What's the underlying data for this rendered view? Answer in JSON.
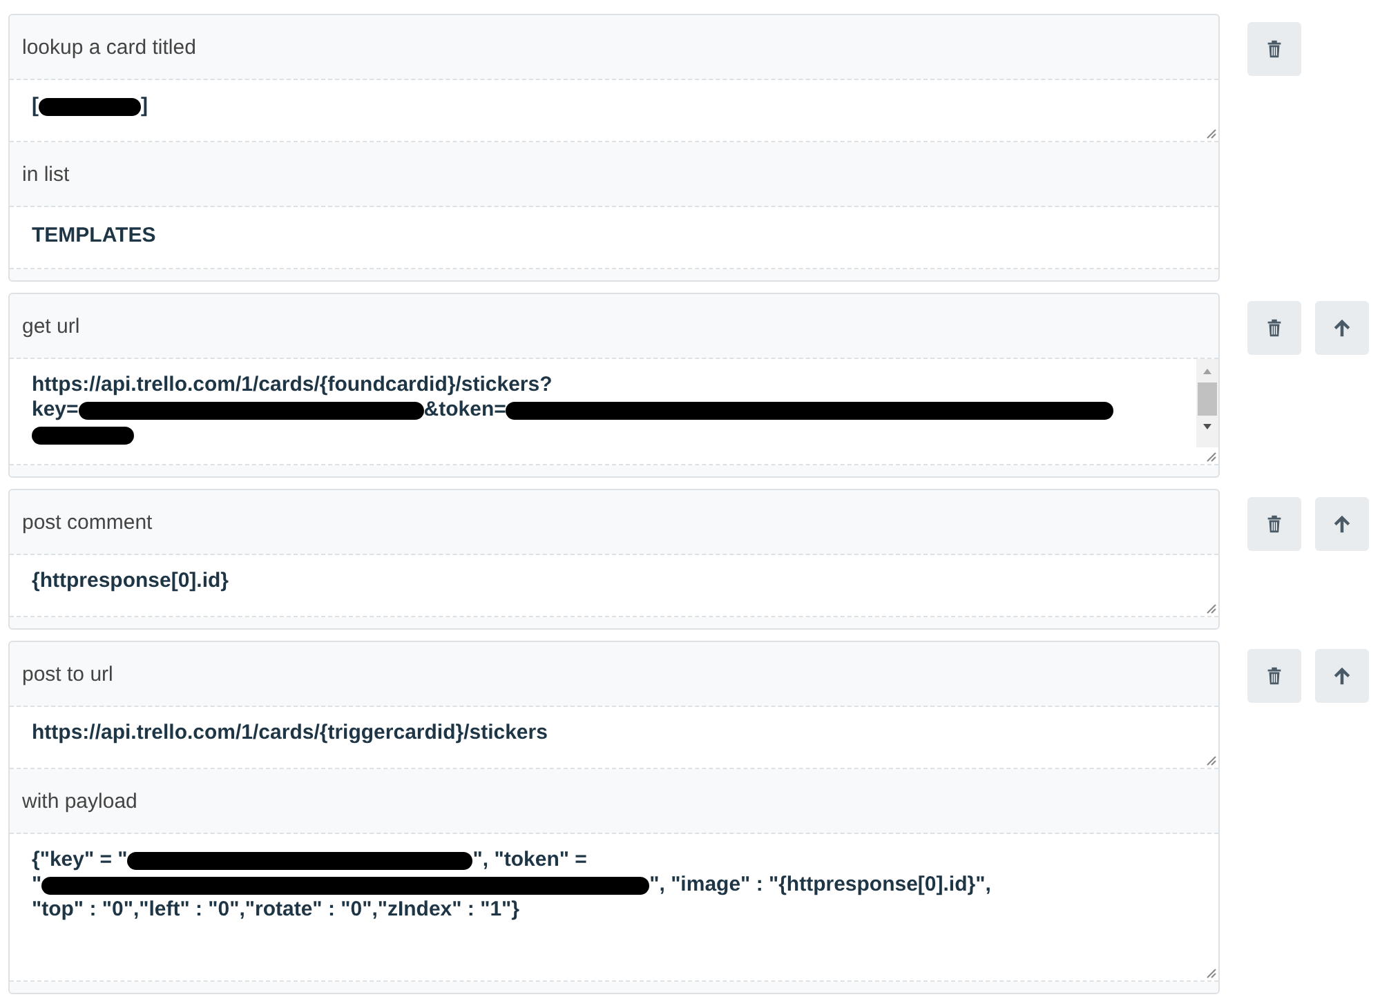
{
  "actions": [
    {
      "fields": [
        {
          "label": "lookup a card titled",
          "kind": "textarea",
          "resizable": true,
          "scrollbar": false,
          "lines": [
            [
              {
                "kind": "text",
                "text": "["
              },
              {
                "kind": "redaction"
              },
              {
                "kind": "text",
                "text": "]"
              }
            ]
          ]
        },
        {
          "label": "in list",
          "kind": "select",
          "resizable": false,
          "scrollbar": false,
          "lines": [
            [
              {
                "kind": "text",
                "text": "TEMPLATES"
              }
            ]
          ]
        }
      ],
      "buttons": [
        {
          "kind": "delete"
        }
      ]
    },
    {
      "fields": [
        {
          "label": "get url",
          "kind": "textarea",
          "resizable": true,
          "scrollbar": true,
          "lines": [
            [
              {
                "kind": "text",
                "text": "https://api.trello.com/1/cards/{foundcardid}/stickers?"
              }
            ],
            [
              {
                "kind": "text",
                "text": "key="
              },
              {
                "kind": "redaction"
              },
              {
                "kind": "text",
                "text": "&token="
              },
              {
                "kind": "redaction"
              }
            ],
            [
              {
                "kind": "redaction"
              }
            ]
          ]
        }
      ],
      "buttons": [
        {
          "kind": "delete"
        },
        {
          "kind": "move-up"
        }
      ]
    },
    {
      "fields": [
        {
          "label": "post comment",
          "kind": "textarea",
          "resizable": true,
          "scrollbar": false,
          "lines": [
            [
              {
                "kind": "text",
                "text": "{httpresponse[0].id}"
              }
            ]
          ]
        }
      ],
      "buttons": [
        {
          "kind": "delete"
        },
        {
          "kind": "move-up"
        }
      ]
    },
    {
      "fields": [
        {
          "label": "post to url",
          "kind": "textarea",
          "resizable": true,
          "scrollbar": false,
          "lines": [
            [
              {
                "kind": "text",
                "text": "https://api.trello.com/1/cards/{triggercardid}/stickers"
              }
            ]
          ]
        },
        {
          "label": "with payload",
          "kind": "textarea",
          "resizable": true,
          "scrollbar": false,
          "lines": [
            [
              {
                "kind": "text",
                "text": "{\"key\" = \""
              },
              {
                "kind": "redaction"
              },
              {
                "kind": "text",
                "text": "\", \"token\" ="
              }
            ],
            [
              {
                "kind": "text",
                "text": "\""
              },
              {
                "kind": "redaction"
              },
              {
                "kind": "text",
                "text": "\", \"image\" : \"{httpresponse[0].id}\","
              }
            ],
            [
              {
                "kind": "text",
                "text": "\"top\" : \"0\",\"left\" : \"0\",\"rotate\" : \"0\",\"zIndex\" : \"1\"}"
              }
            ]
          ]
        }
      ],
      "buttons": [
        {
          "kind": "delete"
        },
        {
          "kind": "move-up"
        }
      ]
    }
  ]
}
